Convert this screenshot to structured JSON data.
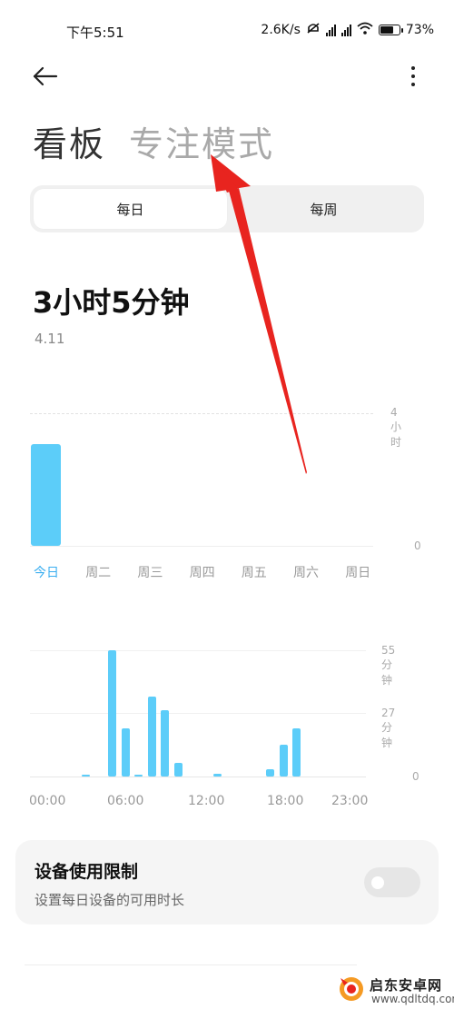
{
  "status_bar": {
    "time": "下午5:51",
    "net_speed": "2.6K/s",
    "battery": "73%",
    "battery_level": 0.73
  },
  "icons": {
    "back": "back-arrow-icon",
    "more": "more-vertical-icon"
  },
  "title_tabs": {
    "active": "看板",
    "inactive": "专注模式"
  },
  "segment": {
    "daily": "每日",
    "weekly": "每周"
  },
  "summary": {
    "total": "3小时5分钟",
    "date": "4.11"
  },
  "weekly_chart": {
    "y_top_label": "4小时",
    "y_bottom_label": "0",
    "days": [
      "今日",
      "周二",
      "周三",
      "周四",
      "周五",
      "周六",
      "周日"
    ],
    "active_day": "今日",
    "accent": "#5ccdf9",
    "active_label_color": "#3aaef0"
  },
  "hourly_chart": {
    "y_labels": [
      "55分钟",
      "27分钟",
      "0"
    ],
    "x_labels": [
      "00:00",
      "06:00",
      "12:00",
      "18:00",
      "23:00"
    ]
  },
  "chart_data": [
    {
      "type": "bar",
      "categories": [
        "今日",
        "周二",
        "周三",
        "周四",
        "周五",
        "周六",
        "周日"
      ],
      "values": [
        3.08,
        0,
        0,
        0,
        0,
        0,
        0
      ],
      "ylim": [
        0,
        4
      ],
      "ylabel": "",
      "xlabel": ""
    },
    {
      "type": "bar",
      "categories": [
        "00",
        "01",
        "02",
        "03",
        "04",
        "05",
        "06",
        "07",
        "08",
        "09",
        "10",
        "11",
        "12",
        "13",
        "14",
        "15",
        "16",
        "17",
        "18",
        "19",
        "20",
        "21",
        "22",
        "23"
      ],
      "values": [
        0,
        0,
        0,
        0.5,
        0,
        55,
        21,
        0.5,
        35,
        29,
        6,
        0,
        0,
        1,
        0,
        0,
        0,
        3,
        14,
        21,
        0,
        0,
        0,
        0
      ],
      "ylim": [
        0,
        55
      ],
      "ylabel": "",
      "xlabel": ""
    }
  ],
  "limit_card": {
    "title": "设备使用限制",
    "subtitle": "设置每日设备的可用时长",
    "enabled": false
  },
  "watermark": {
    "text": "启东安卓网",
    "url": "www.qdltdq.com"
  }
}
